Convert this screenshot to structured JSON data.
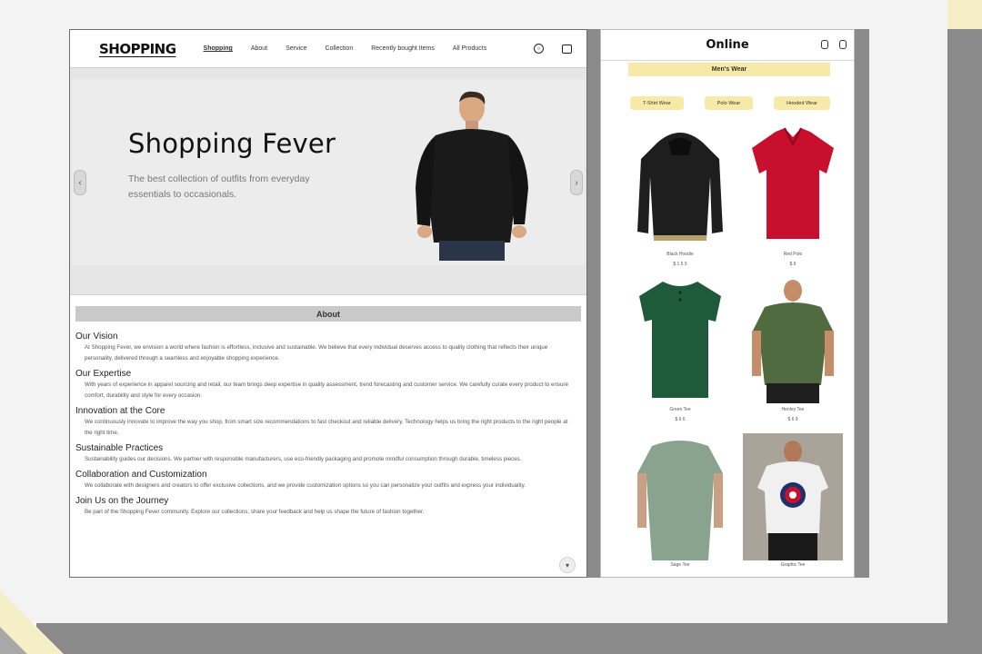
{
  "left": {
    "logo": "SHOPPING",
    "nav": [
      "Shopping",
      "About",
      "Service",
      "Collection",
      "Recently bought Items",
      "All Products"
    ],
    "hero": {
      "title": "Shopping Fever",
      "subtitle": "The best collection of outfits from everyday essentials to occasionals."
    },
    "about_label": "About",
    "sections": [
      {
        "title": "Our Vision",
        "body": "At Shopping Fever, we envision a world where fashion is effortless, inclusive and sustainable. We believe that every individual deserves access to quality clothing that reflects their unique personality, delivered through a seamless and enjoyable shopping experience."
      },
      {
        "title": "Our Expertise",
        "body": "With years of experience in apparel sourcing and retail, our team brings deep expertise in quality assessment, trend forecasting and customer service. We carefully curate every product to ensure comfort, durability and style for every occasion."
      },
      {
        "title": "Innovation at the Core",
        "body": "We continuously innovate to improve the way you shop, from smart size recommendations to fast checkout and reliable delivery. Technology helps us bring the right products to the right people at the right time."
      },
      {
        "title": "Sustainable Practices",
        "body": "Sustainability guides our decisions. We partner with responsible manufacturers, use eco-friendly packaging and promote mindful consumption through durable, timeless pieces."
      },
      {
        "title": "Collaboration and Customization",
        "body": "We collaborate with designers and creators to offer exclusive collections, and we provide customization options so you can personalize your outfits and express your individuality."
      },
      {
        "title": "Join Us on the Journey",
        "body": "Be part of the Shopping Fever community. Explore our collections, share your feedback and help us shape the future of fashion together."
      }
    ]
  },
  "right": {
    "logo": "Online",
    "menu_label": "Men's Wear",
    "categories": [
      "T-Shirt Wear",
      "Polo Wear",
      "Hooded Wear"
    ],
    "products": [
      {
        "name": "Black Hoodie",
        "price": "$ 1 5 5",
        "color": "#1e1e1e"
      },
      {
        "name": "Red Polo",
        "price": "$ 9",
        "color": "#c8102e"
      },
      {
        "name": "Green Tee",
        "price": "$ 6 6",
        "color": "#1f5a3a"
      },
      {
        "name": "Henley Tee",
        "price": "$ 6 9",
        "color": "#4f6b3f"
      },
      {
        "name": "Sage Tee",
        "price": "",
        "color": "#8aa38e"
      },
      {
        "name": "Graphic Tee",
        "price": "",
        "color": "#f0f0f0"
      }
    ]
  },
  "hero_shirt_color": "#1a1a1a"
}
